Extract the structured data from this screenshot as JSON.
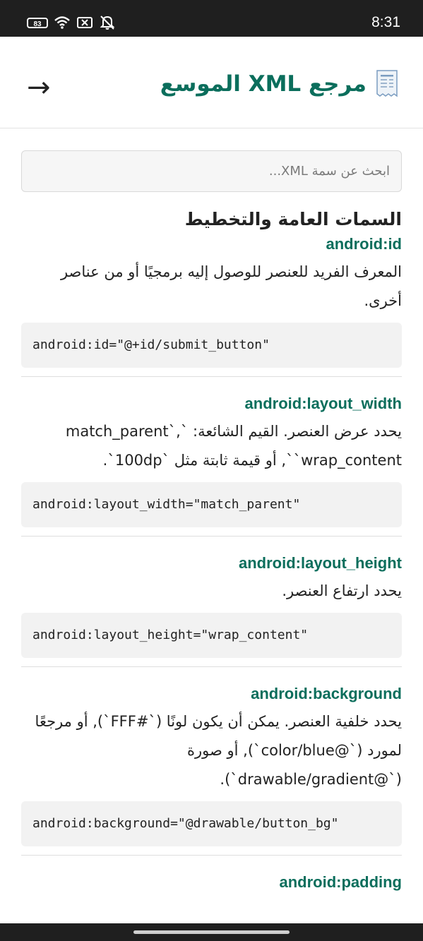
{
  "status_bar": {
    "battery": "83",
    "time": "8:31"
  },
  "header": {
    "title": "مرجع XML الموسع",
    "back_icon": "arrow-right-icon",
    "title_icon": "receipt-icon"
  },
  "search": {
    "placeholder": "ابحث عن سمة XML..."
  },
  "section": {
    "title": "السمات العامة والتخطيط"
  },
  "attributes": [
    {
      "name": "android:id",
      "description": "المعرف الفريد للعنصر للوصول إليه برمجيًا أو من عناصر أخرى.",
      "code": "android:id=\"@+id/submit_button\""
    },
    {
      "name": "android:layout_width",
      "description": "يحدد عرض العنصر. القيم الشائعة: `match_parent`, `wrap_content`, أو قيمة ثابتة مثل `100dp`.",
      "code": "android:layout_width=\"match_parent\""
    },
    {
      "name": "android:layout_height",
      "description": "يحدد ارتفاع العنصر.",
      "code": "android:layout_height=\"wrap_content\""
    },
    {
      "name": "android:background",
      "description": "يحدد خلفية العنصر. يمكن أن يكون لونًا (`#FFF`), أو مرجعًا لمورد (`@color/blue`), أو صورة (`@drawable/gradient`).",
      "code": "android:background=\"@drawable/button_bg\""
    },
    {
      "name": "android:padding"
    }
  ],
  "colors": {
    "accent": "#0b6e5c",
    "status_bar": "#1f1f1f"
  }
}
